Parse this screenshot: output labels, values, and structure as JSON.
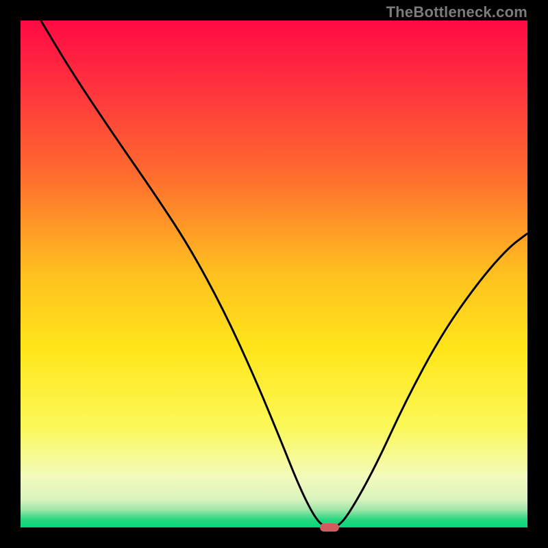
{
  "watermark": "TheBottleneck.com",
  "chart_data": {
    "type": "line",
    "title": "",
    "xlabel": "",
    "ylabel": "",
    "xlim": [
      0,
      100
    ],
    "ylim": [
      0,
      100
    ],
    "gradient_stops": [
      {
        "offset": 0.0,
        "color": "#ff0a44"
      },
      {
        "offset": 0.12,
        "color": "#ff2f3e"
      },
      {
        "offset": 0.3,
        "color": "#ff6a2f"
      },
      {
        "offset": 0.5,
        "color": "#ffc11f"
      },
      {
        "offset": 0.65,
        "color": "#ffe61a"
      },
      {
        "offset": 0.8,
        "color": "#fbf857"
      },
      {
        "offset": 0.9,
        "color": "#f3fbbc"
      },
      {
        "offset": 0.945,
        "color": "#d9f3bd"
      },
      {
        "offset": 0.965,
        "color": "#9fe6a8"
      },
      {
        "offset": 0.985,
        "color": "#26d77e"
      },
      {
        "offset": 1.0,
        "color": "#00d879"
      }
    ],
    "series": [
      {
        "name": "bottleneck-curve",
        "color": "#000000",
        "x": [
          4,
          10,
          18,
          27,
          33.5,
          40,
          46,
          51,
          55,
          58,
          60,
          62.5,
          65,
          70,
          76,
          83,
          90,
          96,
          100
        ],
        "y": [
          100,
          90,
          78,
          65,
          55,
          43,
          30,
          18,
          8,
          2,
          0,
          0,
          3,
          12,
          25,
          38,
          48,
          55,
          58
        ]
      }
    ],
    "marker": {
      "x": 61,
      "y": 0,
      "color": "#cf5d60"
    }
  }
}
